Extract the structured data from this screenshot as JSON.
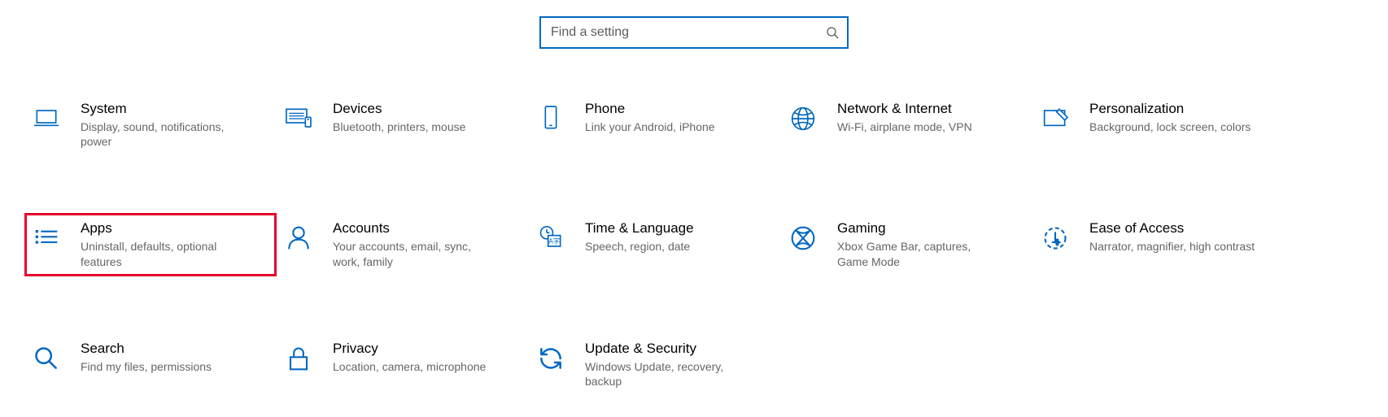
{
  "search": {
    "placeholder": "Find a setting"
  },
  "categories": [
    {
      "id": "system",
      "icon": "laptop-icon",
      "title": "System",
      "desc": "Display, sound, notifications, power",
      "highlight": false
    },
    {
      "id": "devices",
      "icon": "keyboard-icon",
      "title": "Devices",
      "desc": "Bluetooth, printers, mouse",
      "highlight": false
    },
    {
      "id": "phone",
      "icon": "phone-icon",
      "title": "Phone",
      "desc": "Link your Android, iPhone",
      "highlight": false
    },
    {
      "id": "network",
      "icon": "globe-icon",
      "title": "Network & Internet",
      "desc": "Wi-Fi, airplane mode, VPN",
      "highlight": false
    },
    {
      "id": "personalization",
      "icon": "personalize-icon",
      "title": "Personalization",
      "desc": "Background, lock screen, colors",
      "highlight": false
    },
    {
      "id": "apps",
      "icon": "apps-icon",
      "title": "Apps",
      "desc": "Uninstall, defaults, optional features",
      "highlight": true
    },
    {
      "id": "accounts",
      "icon": "person-icon",
      "title": "Accounts",
      "desc": "Your accounts, email, sync, work, family",
      "highlight": false
    },
    {
      "id": "time",
      "icon": "time-language-icon",
      "title": "Time & Language",
      "desc": "Speech, region, date",
      "highlight": false
    },
    {
      "id": "gaming",
      "icon": "gaming-icon",
      "title": "Gaming",
      "desc": "Xbox Game Bar, captures, Game Mode",
      "highlight": false
    },
    {
      "id": "ease",
      "icon": "ease-icon",
      "title": "Ease of Access",
      "desc": "Narrator, magnifier, high contrast",
      "highlight": false
    },
    {
      "id": "search",
      "icon": "search-cat-icon",
      "title": "Search",
      "desc": "Find my files, permissions",
      "highlight": false
    },
    {
      "id": "privacy",
      "icon": "lock-icon",
      "title": "Privacy",
      "desc": "Location, camera, microphone",
      "highlight": false
    },
    {
      "id": "update",
      "icon": "update-icon",
      "title": "Update & Security",
      "desc": "Windows Update, recovery, backup",
      "highlight": false
    }
  ]
}
